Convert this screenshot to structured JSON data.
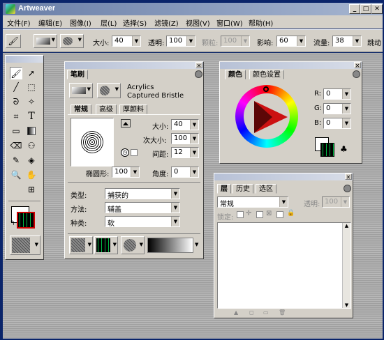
{
  "app": {
    "title": "Artweaver"
  },
  "menu": [
    "文件(F)",
    "编辑(E)",
    "图像(I)",
    "层(L)",
    "选择(S)",
    "滤镜(Z)",
    "视图(V)",
    "窗口(W)",
    "帮助(H)"
  ],
  "options": {
    "size_label": "大小:",
    "size_value": "40",
    "opacity_label": "透明:",
    "opacity_value": "100",
    "grain_label": "颗粒:",
    "grain_value": "100",
    "influence_label": "影响:",
    "influence_value": "60",
    "flow_label": "流量:",
    "flow_value": "38",
    "jitter_label": "跳动"
  },
  "brush_panel": {
    "title": "笔刷",
    "category": "Acrylics",
    "variant": "Captured Bristle",
    "tabs": [
      "常规",
      "高级",
      "厚颜料"
    ],
    "size_label": "大小:",
    "size_value": "40",
    "min_size_label": "次大小:",
    "min_size_value": "100",
    "spacing_label": "间距:",
    "spacing_value": "12",
    "ellipse_label": "椭圆形:",
    "ellipse_value": "100",
    "angle_label": "角度:",
    "angle_value": "0",
    "type_label": "类型:",
    "type_value": "捕获的",
    "method_label": "方法:",
    "method_value": "辅盖",
    "kind_label": "种类:",
    "kind_value": "软"
  },
  "color_panel": {
    "tabs": [
      "颜色",
      "颜色设置"
    ],
    "r_label": "R:",
    "r_value": "0",
    "g_label": "G:",
    "g_value": "0",
    "b_label": "B:",
    "b_value": "0",
    "accent": "#cc1111"
  },
  "layer_panel": {
    "tabs": [
      "层",
      "历史",
      "选区"
    ],
    "blend_value": "常规",
    "opacity_label": "透明:",
    "opacity_value": "100",
    "lock_label": "锁定:"
  }
}
